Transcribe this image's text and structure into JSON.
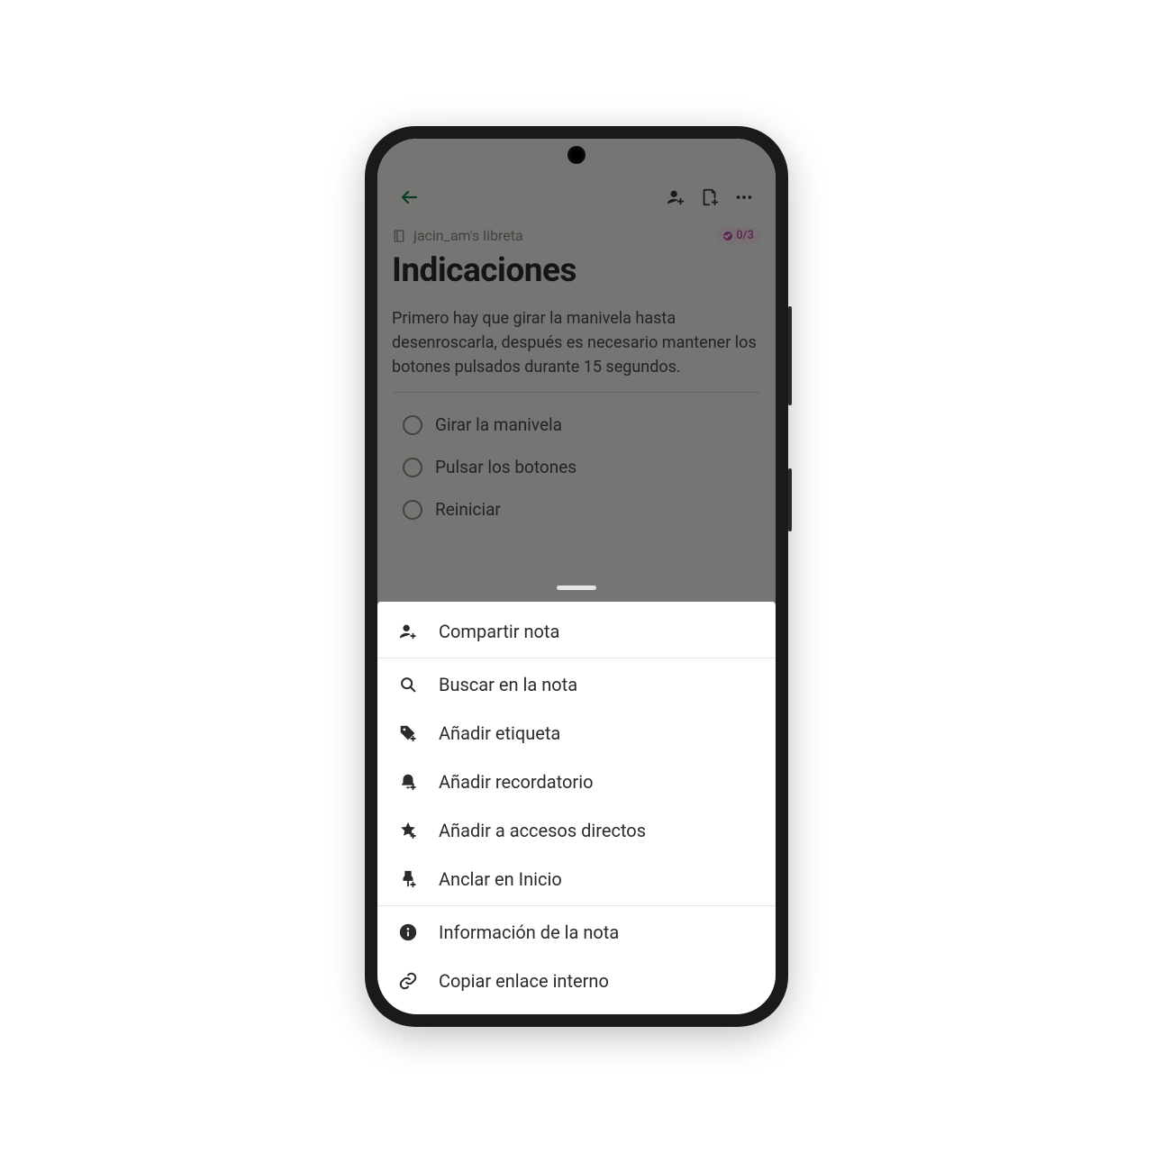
{
  "notebook": {
    "name": "jacin_am's libreta",
    "progress": "0/3"
  },
  "note": {
    "title": "Indicaciones",
    "body": "Primero hay que girar la manivela hasta desenroscarla, después es necesario mantener los botones pulsados durante 15 segundos."
  },
  "checklist": [
    {
      "label": "Girar la manivela"
    },
    {
      "label": "Pulsar los botones"
    },
    {
      "label": "Reiniciar"
    }
  ],
  "menu": {
    "share": "Compartir nota",
    "search": "Buscar en la nota",
    "tag": "Añadir etiqueta",
    "reminder": "Añadir recordatorio",
    "shortcut": "Añadir a accesos directos",
    "pin": "Anclar en Inicio",
    "info": "Información de la nota",
    "link": "Copiar enlace interno"
  }
}
